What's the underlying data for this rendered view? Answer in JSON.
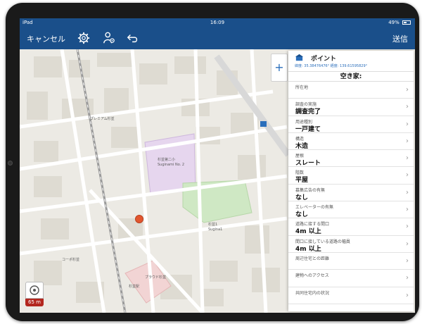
{
  "status_bar": {
    "device": "iPad",
    "time": "16:09",
    "battery": "49%"
  },
  "toolbar": {
    "cancel_label": "キャンセル",
    "send_label": "送信"
  },
  "map": {
    "scale_label": "65 m",
    "labels": [
      {
        "text": "杉並第二小",
        "kind": "school"
      },
      {
        "text": "Suginami No. 2",
        "kind": "school-en"
      },
      {
        "text": "杉並1",
        "kind": "park"
      },
      {
        "text": "Sugina1",
        "kind": "park-en"
      },
      {
        "text": "プラウド杉並",
        "kind": "building"
      },
      {
        "text": "プレミアム杉並",
        "kind": "building"
      },
      {
        "text": "杉並駅",
        "kind": "station"
      },
      {
        "text": "コーポ杉並",
        "kind": "building"
      }
    ],
    "colors": {
      "background": "#eceae4",
      "road": "#ffffff",
      "school": "#e6d6ee",
      "park": "#cfe8c4",
      "rail": "#9a9a9a",
      "marker": "#e2562f"
    }
  },
  "panel": {
    "title": "ポイント",
    "coords": "緯度: 35.38476476° 経度: 139.61595829°",
    "subtitle": "空き家:",
    "fields": [
      {
        "label": "所在地",
        "value": ""
      },
      {
        "label": "調査の実施",
        "value": "調査完了"
      },
      {
        "label": "用途種別",
        "value": "一戸建て"
      },
      {
        "label": "構造",
        "value": "木造"
      },
      {
        "label": "屋根",
        "value": "スレート"
      },
      {
        "label": "階数",
        "value": "平屋"
      },
      {
        "label": "募集広告の有無",
        "value": "なし"
      },
      {
        "label": "エレベーターの有無",
        "value": "なし"
      },
      {
        "label": "道路に接する間口",
        "value": "4m 以上"
      },
      {
        "label": "間口に接している道路の幅員",
        "value": "4m 以上"
      },
      {
        "label": "周辺住宅との距離",
        "value": ""
      },
      {
        "label": "建物へのアクセス",
        "value": ""
      },
      {
        "label": "共同住宅内の状況",
        "value": ""
      }
    ],
    "accent": "#2a6ebb"
  },
  "icons": [
    "gear-icon",
    "user-settings-icon",
    "undo-icon",
    "plus-icon",
    "locate-icon",
    "pin-icon",
    "chevron-right-icon"
  ]
}
